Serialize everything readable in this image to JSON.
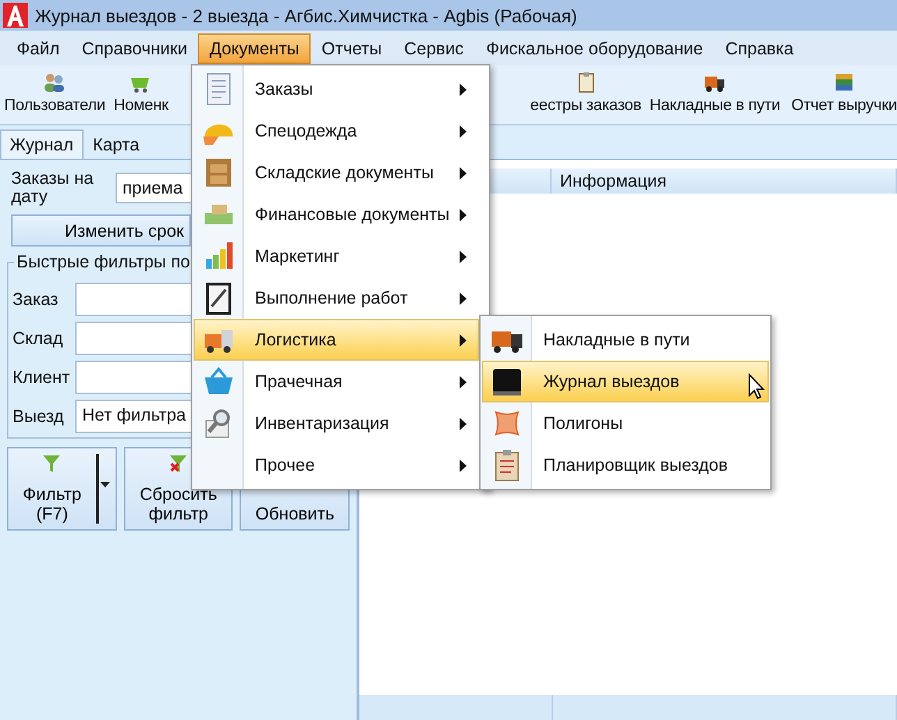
{
  "window": {
    "title": "Журнал выездов - 2 выезда - Агбис.Химчистка - Agbis (Рабочая)"
  },
  "menu_bar": [
    {
      "label": "Файл",
      "selected": false
    },
    {
      "label": "Справочники",
      "selected": false
    },
    {
      "label": "Документы",
      "selected": true
    },
    {
      "label": "Отчеты",
      "selected": false
    },
    {
      "label": "Сервис",
      "selected": false
    },
    {
      "label": "Фискальное оборудование",
      "selected": false
    },
    {
      "label": "Справка",
      "selected": false
    }
  ],
  "toolbar": [
    {
      "label": "Пользователи"
    },
    {
      "label": "Номенк"
    },
    {
      "label": "еестры заказов"
    },
    {
      "label": "Накладные в пути"
    },
    {
      "label": "Отчет выручки"
    }
  ],
  "tabs": [
    {
      "label": "Журнал",
      "selected": true
    },
    {
      "label": "Карта",
      "selected": false
    }
  ],
  "date_filter": {
    "label": "Заказы на дату",
    "value": "приема",
    "button": "Изменить срок"
  },
  "quick_filters": {
    "title": "Быстрые фильтры по",
    "fields": [
      {
        "label": "Заказ"
      },
      {
        "label": "Склад"
      },
      {
        "label": "Клиент"
      },
      {
        "label": "Выезд",
        "value": "Нет фильтра"
      }
    ]
  },
  "buttons": [
    {
      "label": "Фильтр\n(F7)",
      "dropdown": true
    },
    {
      "label": "Сбросить\nфильтр",
      "dropdown": false
    },
    {
      "label": "Обновить",
      "dropdown": false
    }
  ],
  "table": {
    "columns": [
      "",
      "Информация"
    ]
  },
  "menu": [
    {
      "label": "Заказы",
      "submenu": true,
      "selected": false
    },
    {
      "label": "Спецодежда",
      "submenu": true,
      "selected": false
    },
    {
      "label": "Складские документы",
      "submenu": true,
      "selected": false
    },
    {
      "label": "Финансовые документы",
      "submenu": true,
      "selected": false
    },
    {
      "label": "Маркетинг",
      "submenu": true,
      "selected": false
    },
    {
      "label": "Выполнение работ",
      "submenu": true,
      "selected": false
    },
    {
      "label": "Логистика",
      "submenu": true,
      "selected": true
    },
    {
      "label": "Прачечная",
      "submenu": true,
      "selected": false
    },
    {
      "label": "Инвентаризация",
      "submenu": true,
      "selected": false
    },
    {
      "label": "Прочее",
      "submenu": true,
      "selected": false
    }
  ],
  "submenu": [
    {
      "label": "Накладные в пути",
      "selected": false
    },
    {
      "label": "Журнал выездов",
      "selected": true
    },
    {
      "label": "Полигоны",
      "selected": false
    },
    {
      "label": "Планировщик выездов",
      "selected": false
    }
  ]
}
